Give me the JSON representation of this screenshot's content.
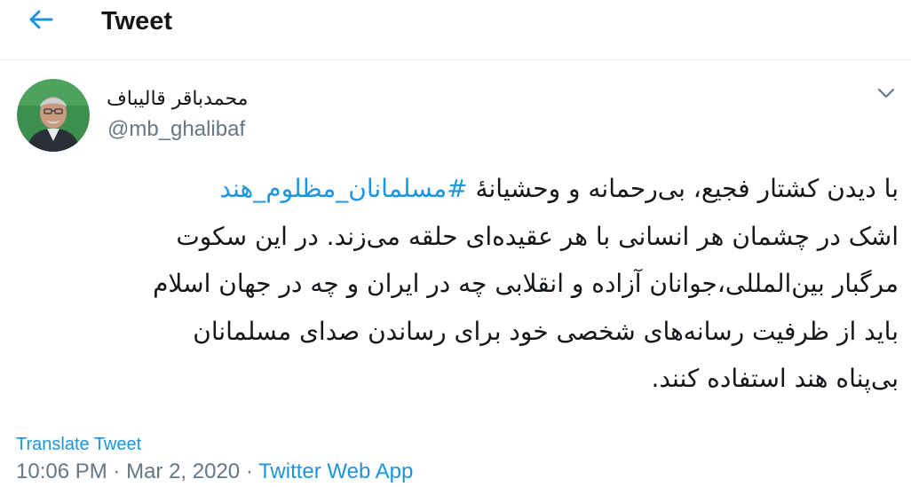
{
  "header": {
    "back_icon": "arrow-left-icon",
    "title": "Tweet"
  },
  "author": {
    "display_name": "محمدباقر قالیباف",
    "handle": "@mb_ghalibaf"
  },
  "tweet": {
    "line1_prefix": "با دیدن کشتار فجیع، بی‌رحمانه و وحشیانهٔ ",
    "hashtag": "#مسلمانان_مظلوم_هند",
    "line2": "اشک در چشمان هر انسانی با هر عقیده‌ای حلقه می‌زند. در این سکوت",
    "line3": "مرگبار بین‌المللی،جوانان آزاده و انقلابی چه در ایران و چه در جهان اسلام",
    "line4": "باید از ظرفیت رسانه‌های شخصی خود برای رساندن صدای مسلمانان",
    "line5": "بی‌پناه هند استفاده کنند."
  },
  "footer": {
    "translate_label": "Translate Tweet",
    "time": "10:06 PM",
    "separator": "·",
    "date": "Mar 2, 2020",
    "app": "Twitter Web App"
  },
  "colors": {
    "accent": "#1b95e0",
    "text": "#14171a",
    "secondary": "#657786",
    "divider": "#e6ecf0",
    "avatar_bg": "#3d8f4e"
  }
}
